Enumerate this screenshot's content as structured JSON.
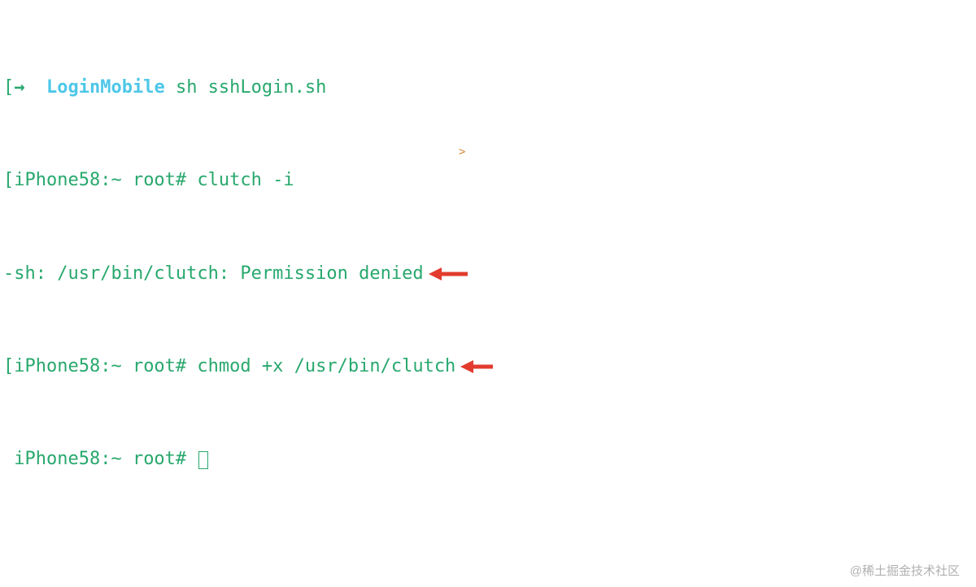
{
  "terminal": {
    "lines": [
      {
        "prefix_bracket": "[",
        "arrow": "→  ",
        "dir": "LoginMobile",
        "rest": " sh sshLogin.sh",
        "has_red_arrow": false
      },
      {
        "prefix_bracket": "[",
        "prompt": "iPhone58:~ root# ",
        "rest": "clutch -i",
        "has_red_arrow": false
      },
      {
        "prefix_bracket": "",
        "prompt": "-sh: /usr/bin/clutch: Permission denied",
        "rest": "",
        "has_red_arrow": true
      },
      {
        "prefix_bracket": "[",
        "prompt": "iPhone58:~ root# ",
        "rest": "chmod +x /usr/bin/clutch",
        "has_red_arrow": true
      },
      {
        "prefix_bracket": " ",
        "prompt": "iPhone58:~ root# ",
        "rest": "",
        "has_red_arrow": false,
        "has_cursor": true
      }
    ]
  },
  "watermark": "@稀土掘金技术社区",
  "stray_mark": ">"
}
